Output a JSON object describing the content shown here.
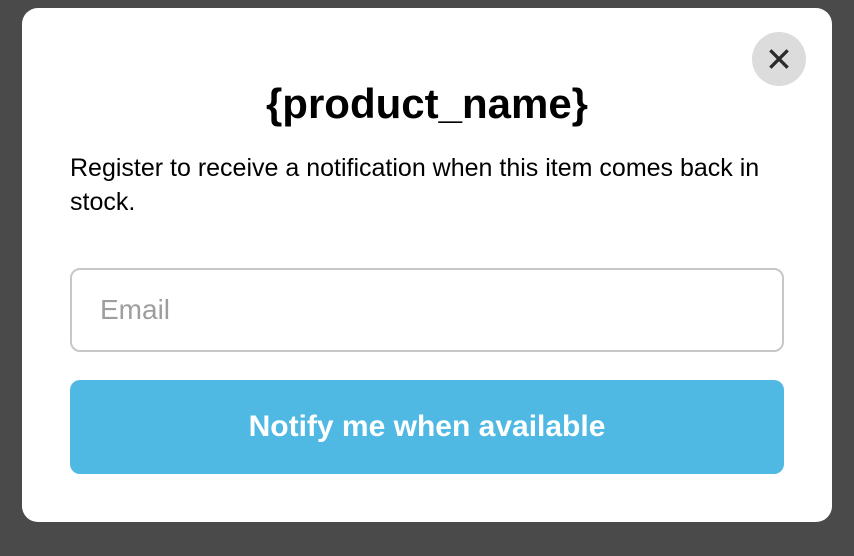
{
  "modal": {
    "title": "{product_name}",
    "description": "Register to receive a notification when this item comes back in stock.",
    "email_placeholder": "Email",
    "email_value": "",
    "notify_button_label": "Notify me when available"
  }
}
